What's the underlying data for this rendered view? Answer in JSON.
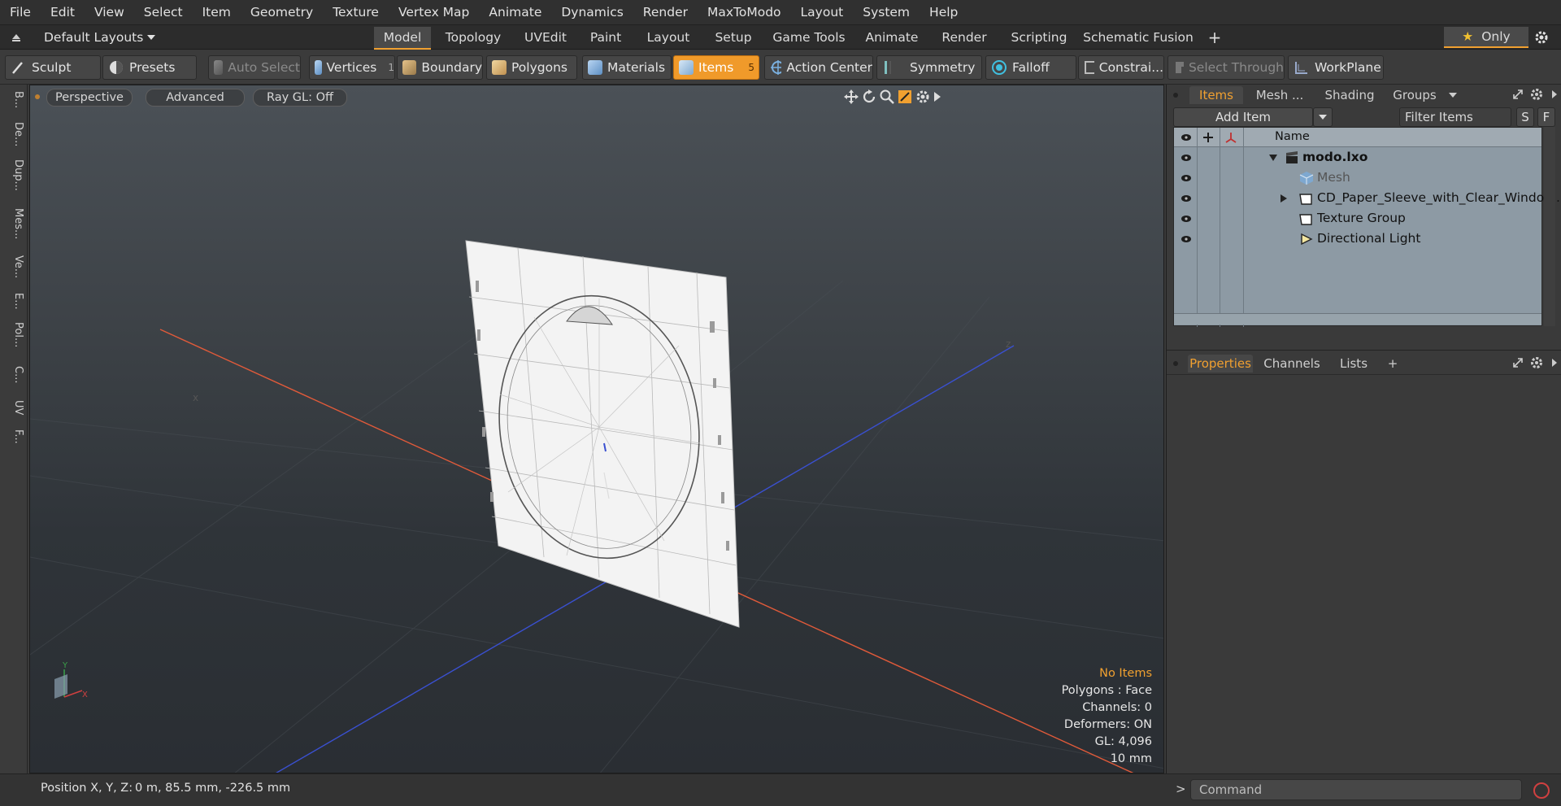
{
  "menu": [
    "File",
    "Edit",
    "View",
    "Select",
    "Item",
    "Geometry",
    "Texture",
    "Vertex Map",
    "Animate",
    "Dynamics",
    "Render",
    "MaxToModo",
    "Layout",
    "System",
    "Help"
  ],
  "layout_bar": {
    "layouts_label": "Default Layouts",
    "tabs": [
      "Model",
      "Topology",
      "UVEdit",
      "Paint",
      "Layout",
      "Setup",
      "Game Tools",
      "Animate",
      "Render",
      "Scripting",
      "Schematic Fusion"
    ],
    "active_tab": "Model",
    "plus_label": "+",
    "only_label": "Only",
    "only_star": "★"
  },
  "toolbar": {
    "sculpt": "Sculpt",
    "presets": "Presets",
    "auto_select": "Auto Select",
    "vertices": "Vertices",
    "vertices_count": "1",
    "boundary": "Boundary",
    "polygons": "Polygons",
    "materials": "Materials",
    "items": "Items",
    "items_count": "5",
    "action_center": "Action Center",
    "symmetry": "Symmetry",
    "falloff": "Falloff",
    "constraints": "Constrai...",
    "select_through": "Select Through",
    "workplane": "WorkPlane"
  },
  "left_tools": [
    "B...",
    "De...",
    "Dup...",
    "Mes...",
    "Ve...",
    "E...",
    "Pol...",
    "C...",
    "UV",
    "F..."
  ],
  "viewport": {
    "view_mode": "Perspective",
    "shading": "Advanced",
    "ray_gl": "Ray GL: Off",
    "stats": {
      "selection": "No Items",
      "polygons": "Polygons : Face",
      "channels": "Channels: 0",
      "deformers": "Deformers: ON",
      "gl": "GL: 4,096",
      "grid": "10 mm"
    },
    "colors": {
      "selection_highlight": "#f0a030",
      "x_axis": "#e05a3a",
      "z_axis": "#3a50d0"
    }
  },
  "status": {
    "position_label": "Position X, Y, Z:",
    "position_value": "0 m, 85.5 mm, -226.5 mm"
  },
  "items_panel": {
    "tabs": [
      "Items",
      "Mesh ...",
      "Shading",
      "Groups"
    ],
    "active_tab": "Items",
    "add_item": "Add Item",
    "filter_placeholder": "Filter Items",
    "s_btn": "S",
    "f_btn": "F",
    "name_header": "Name",
    "tree": [
      {
        "label": "modo.lxo",
        "bold": true
      },
      {
        "label": "Mesh",
        "dim": true
      },
      {
        "label": "CD_Paper_Sleeve_with_Clear_Windo ..."
      },
      {
        "label": "Texture Group"
      },
      {
        "label": "Directional Light"
      }
    ]
  },
  "properties_panel": {
    "tabs": [
      "Properties",
      "Channels",
      "Lists"
    ],
    "active_tab": "Properties",
    "plus_label": "+"
  },
  "command": {
    "placeholder": "Command",
    "prompt": ">"
  }
}
